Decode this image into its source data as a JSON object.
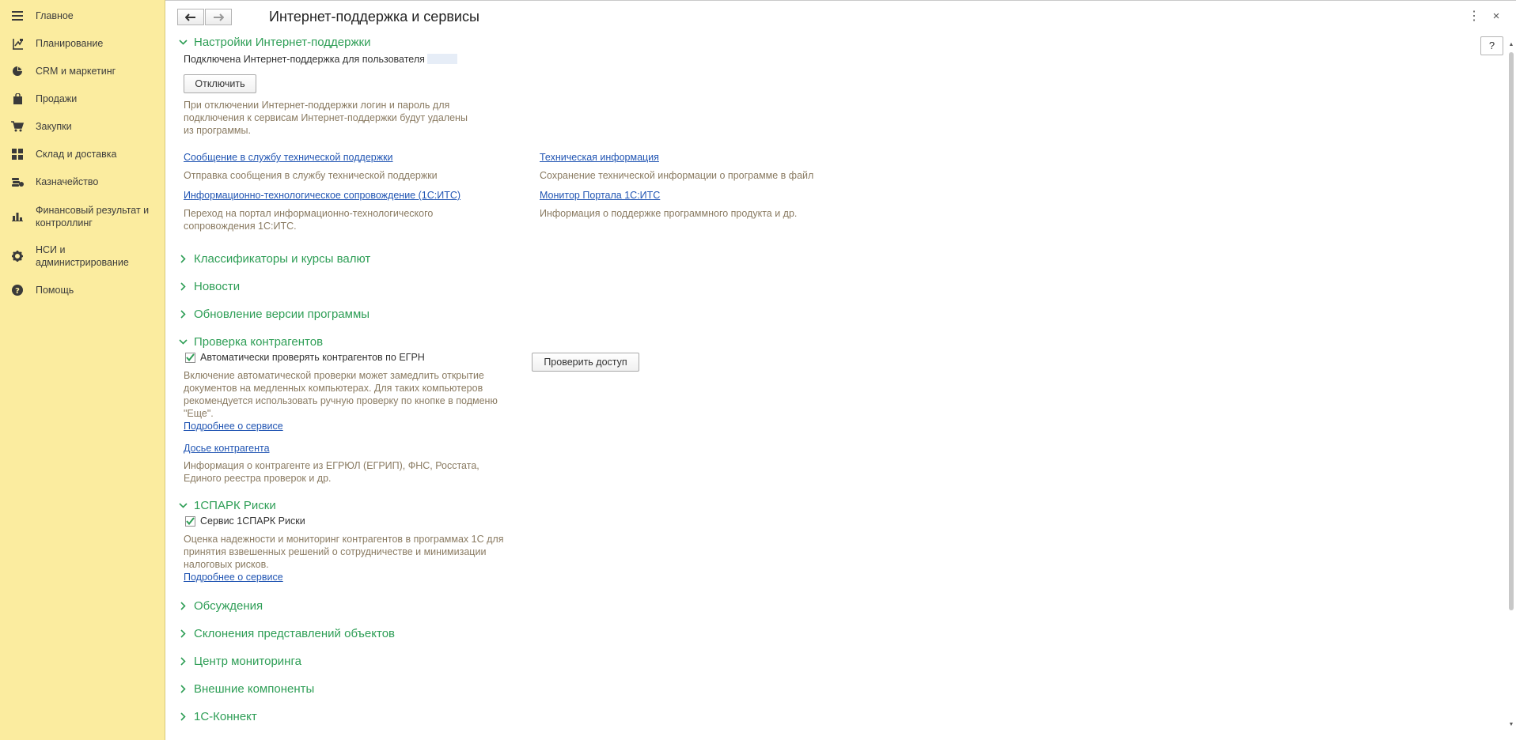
{
  "sidebar": {
    "items": [
      {
        "label": "Главное",
        "icon": "menu-icon"
      },
      {
        "label": "Планирование",
        "icon": "planning-icon"
      },
      {
        "label": "CRM и маркетинг",
        "icon": "pie-chart-icon"
      },
      {
        "label": "Продажи",
        "icon": "bag-icon"
      },
      {
        "label": "Закупки",
        "icon": "cart-icon"
      },
      {
        "label": "Склад и доставка",
        "icon": "grid-icon"
      },
      {
        "label": "Казначейство",
        "icon": "coins-icon"
      },
      {
        "label": "Финансовый результат и контроллинг",
        "icon": "bar-chart-icon"
      },
      {
        "label": "НСИ и администрирование",
        "icon": "gear-icon"
      },
      {
        "label": "Помощь",
        "icon": "question-icon"
      }
    ]
  },
  "header": {
    "title": "Интернет-поддержка и сервисы",
    "help_label": "?",
    "more_glyph": "⋮",
    "close_glyph": "×"
  },
  "sections": {
    "support": {
      "title": "Настройки Интернет-поддержки",
      "connected_text": "Подключена Интернет-поддержка для пользователя",
      "disable_button": "Отключить",
      "disable_note": "При отключении Интернет-поддержки логин и пароль для подключения к сервисам Интернет-поддержки будут удалены из программы.",
      "links": [
        {
          "label": "Сообщение в службу технической поддержки",
          "desc": "Отправка сообщения в службу технической поддержки"
        },
        {
          "label": "Техническая информация",
          "desc": "Сохранение технической информации о программе в файл"
        },
        {
          "label": "Информационно-технологическое сопровождение (1С:ИТС)",
          "desc": "Переход на портал информационно-технологического сопровождения 1С:ИТС."
        },
        {
          "label": "Монитор Портала 1С:ИТС",
          "desc": "Информация о поддержке программного продукта и др."
        }
      ]
    },
    "classifiers": {
      "title": "Классификаторы и курсы валют"
    },
    "news": {
      "title": "Новости"
    },
    "update": {
      "title": "Обновление версии программы"
    },
    "counterparty": {
      "title": "Проверка контрагентов",
      "checkbox_label": "Автоматически проверять контрагентов по ЕГРН",
      "checked": true,
      "check_button": "Проверить доступ",
      "note": "Включение автоматической проверки может замедлить открытие документов на медленных компьютерах. Для таких компьютеров рекомендуется использовать ручную проверку по кнопке в подменю \"Еще\".",
      "more_link": "Подробнее о сервисе",
      "dossier_link": "Досье контрагента",
      "dossier_desc": "Информация о контрагенте из ЕГРЮЛ (ЕГРИП), ФНС, Росстата, Единого реестра проверок и др."
    },
    "spark": {
      "title": "1СПАРК Риски",
      "checkbox_label": "Сервис 1СПАРК Риски",
      "checked": true,
      "desc": "Оценка надежности и мониторинг контрагентов в программах 1С для принятия взвешенных решений о сотрудничестве и минимизации налоговых рисков.",
      "more_link": "Подробнее о сервисе"
    },
    "discussions": {
      "title": "Обсуждения"
    },
    "declensions": {
      "title": "Склонения представлений объектов"
    },
    "monitoring": {
      "title": "Центр мониторинга"
    },
    "components": {
      "title": "Внешние компоненты"
    },
    "connect": {
      "title": "1С-Коннект"
    }
  },
  "colors": {
    "sidebar_bg": "#fbec9f",
    "section_title": "#2e9e56",
    "link": "#2155b3",
    "description": "#8a7b62"
  }
}
